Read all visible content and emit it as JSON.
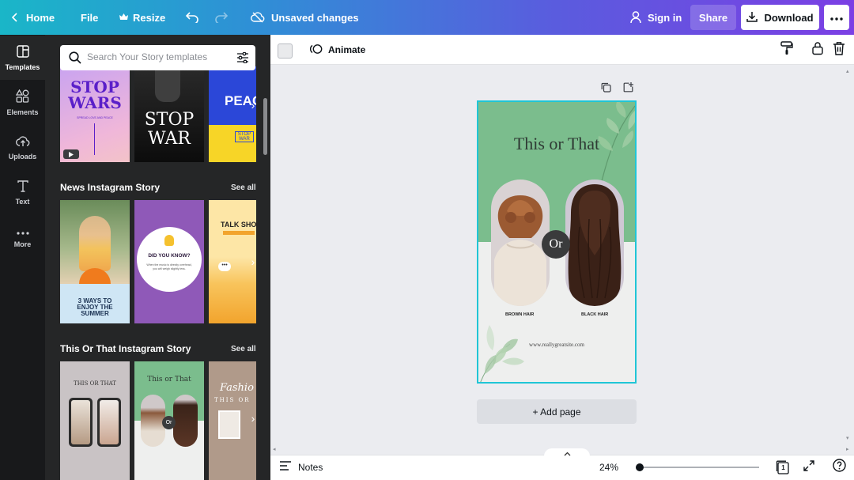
{
  "topbar": {
    "home_label": "Home",
    "file_label": "File",
    "resize_label": "Resize",
    "save_status": "Unsaved changes",
    "sign_in_label": "Sign in",
    "share_label": "Share",
    "download_label": "Download",
    "gradient_colors": [
      "#1ab6c8",
      "#5a5cde",
      "#7b3fe4"
    ]
  },
  "rail": {
    "items": [
      {
        "label": "Templates",
        "icon": "templates-icon"
      },
      {
        "label": "Elements",
        "icon": "elements-icon"
      },
      {
        "label": "Uploads",
        "icon": "upload-cloud-icon"
      },
      {
        "label": "Text",
        "icon": "text-icon"
      },
      {
        "label": "More",
        "icon": "more-dots-icon"
      }
    ]
  },
  "panel": {
    "search_placeholder": "Search Your Story templates",
    "sections": [
      {
        "title": "News Instagram Story",
        "see_all": "See all"
      },
      {
        "title": "This Or That Instagram Story",
        "see_all": "See all"
      }
    ],
    "thumbnails": {
      "row1": [
        {
          "text": "STOP WARS",
          "sub": "SPREAD LOVE AND PEACE"
        },
        {
          "text": "STOP WAR"
        },
        {
          "text": "PEAC",
          "sub": "STOP WAR"
        }
      ],
      "row2": [
        {
          "text": "3 WAYS TO ENJOY THE SUMMER"
        },
        {
          "text": "DID YOU KNOW?",
          "sub": "When the music is directly overhead, you will weigh slightly less."
        },
        {
          "text": "TALK SHO"
        }
      ],
      "row3": [
        {
          "text": "THIS OR THAT"
        },
        {
          "text": "This or That"
        },
        {
          "text": "Fashio",
          "sub": "THIS OR"
        }
      ]
    }
  },
  "toolbar": {
    "animate_label": "Animate"
  },
  "design": {
    "title": "This or That",
    "or_label": "Or",
    "left_label": "BROWN HAIR",
    "right_label": "BLACK HAIR",
    "website": "www.reallygreatsite.com",
    "green": "#7bbd8d",
    "selection_color": "#20c5d6"
  },
  "add_page_label": "+ Add page",
  "footer": {
    "notes_label": "Notes",
    "zoom_value": "24%",
    "page_count": "1"
  }
}
